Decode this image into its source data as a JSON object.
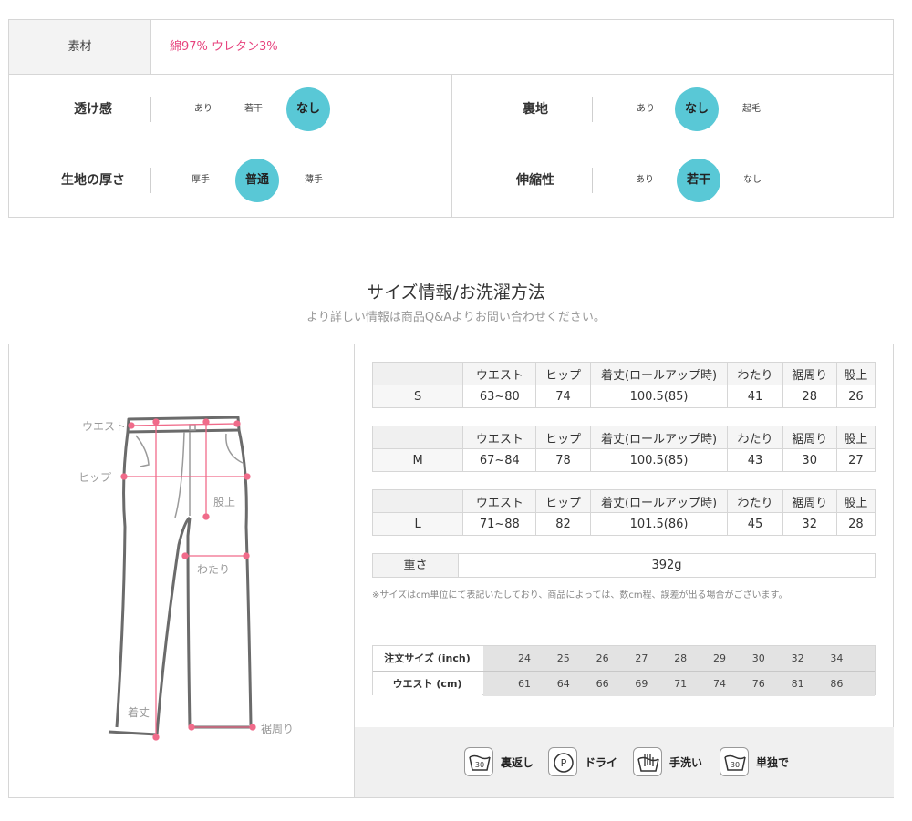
{
  "material": {
    "label": "素材",
    "value": "綿97% ウレタン3%"
  },
  "attributes": [
    {
      "name": "透け感",
      "options": [
        "あり",
        "若干",
        "なし"
      ],
      "selected": 2
    },
    {
      "name": "生地の厚さ",
      "options": [
        "厚手",
        "普通",
        "薄手"
      ],
      "selected": 1
    },
    {
      "name": "裏地",
      "options": [
        "あり",
        "なし",
        "起毛"
      ],
      "selected": 1
    },
    {
      "name": "伸縮性",
      "options": [
        "あり",
        "若干",
        "なし"
      ],
      "selected": 1
    }
  ],
  "section": {
    "title": "サイズ情報/お洗濯方法",
    "subtitle": "より詳しい情報は商品Q&Aよりお問い合わせください。"
  },
  "diagram": {
    "labels": [
      "ウエスト",
      "ヒップ",
      "股上",
      "わたり",
      "着丈",
      "裾周り"
    ]
  },
  "size_tables": {
    "headers": [
      "ウエスト",
      "ヒップ",
      "着丈(ロールアップ時)",
      "わたり",
      "裾周り",
      "股上"
    ],
    "rows": [
      {
        "size": "S",
        "values": [
          "63~80",
          "74",
          "100.5(85)",
          "41",
          "28",
          "26"
        ]
      },
      {
        "size": "M",
        "values": [
          "67~84",
          "78",
          "100.5(85)",
          "43",
          "30",
          "27"
        ]
      },
      {
        "size": "L",
        "values": [
          "71~88",
          "82",
          "101.5(86)",
          "45",
          "32",
          "28"
        ]
      }
    ]
  },
  "weight": {
    "label": "重さ",
    "value": "392g"
  },
  "note": "※サイズはcm単位にて表記いたしており、商品によっては、数cm程、誤差が出る場合がございます。",
  "conversion": {
    "inch_label": "注文サイズ (inch)",
    "cm_label": "ウエスト (cm)",
    "inch": [
      "24",
      "25",
      "26",
      "27",
      "28",
      "29",
      "30",
      "32",
      "34"
    ],
    "cm": [
      "61",
      "64",
      "66",
      "69",
      "71",
      "74",
      "76",
      "81",
      "86"
    ]
  },
  "washing": [
    {
      "icon": "wash-30-icon",
      "label": "裏返し"
    },
    {
      "icon": "dry-clean-p-icon",
      "label": "ドライ"
    },
    {
      "icon": "hand-wash-icon",
      "label": "手洗い"
    },
    {
      "icon": "wash-30-icon",
      "label": "単独で"
    }
  ],
  "colors": {
    "accent": "#59c8d6",
    "material_text": "#e7437e",
    "diagram_pink": "#f06b8a"
  }
}
